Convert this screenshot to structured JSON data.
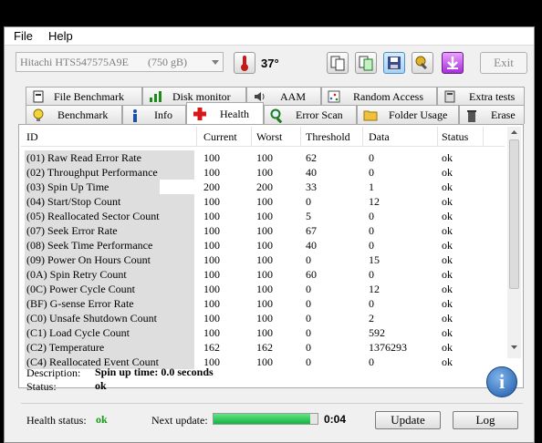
{
  "menu": [
    "File",
    "Help"
  ],
  "toolbar": {
    "drive": "Hitachi HTS547575A9E",
    "capacity": "(750 gB)",
    "temperature": "37°",
    "exit_label": "Exit",
    "icons": [
      "thermometer-icon",
      "copy-icon",
      "copy-green-icon",
      "save-icon",
      "tools-icon",
      "download-icon"
    ]
  },
  "tabs_top": [
    "File Benchmark",
    "Disk monitor",
    "AAM",
    "Random Access",
    "Extra tests"
  ],
  "tabs_bottom": [
    "Benchmark",
    "Info",
    "Health",
    "Error Scan",
    "Folder Usage",
    "Erase"
  ],
  "selected_tab": "Health",
  "table": {
    "headers": [
      "ID",
      "Current",
      "Worst",
      "Threshold",
      "Data",
      "Status"
    ],
    "rows": [
      [
        "(01) Raw Read Error Rate",
        "100",
        "100",
        "62",
        "0",
        "ok"
      ],
      [
        "(02) Throughput Performance",
        "100",
        "100",
        "40",
        "0",
        "ok"
      ],
      [
        "(03) Spin Up Time",
        "200",
        "200",
        "33",
        "1",
        "ok"
      ],
      [
        "(04) Start/Stop Count",
        "100",
        "100",
        "0",
        "12",
        "ok"
      ],
      [
        "(05) Reallocated Sector Count",
        "100",
        "100",
        "5",
        "0",
        "ok"
      ],
      [
        "(07) Seek Error Rate",
        "100",
        "100",
        "67",
        "0",
        "ok"
      ],
      [
        "(08) Seek Time Performance",
        "100",
        "100",
        "40",
        "0",
        "ok"
      ],
      [
        "(09) Power On Hours Count",
        "100",
        "100",
        "0",
        "15",
        "ok"
      ],
      [
        "(0A) Spin Retry Count",
        "100",
        "100",
        "60",
        "0",
        "ok"
      ],
      [
        "(0C) Power Cycle Count",
        "100",
        "100",
        "0",
        "12",
        "ok"
      ],
      [
        "(BF) G-sense Error Rate",
        "100",
        "100",
        "0",
        "0",
        "ok"
      ],
      [
        "(C0) Unsafe Shutdown Count",
        "100",
        "100",
        "0",
        "2",
        "ok"
      ],
      [
        "(C1) Load Cycle Count",
        "100",
        "100",
        "0",
        "592",
        "ok"
      ],
      [
        "(C2) Temperature",
        "162",
        "162",
        "0",
        "1376293",
        "ok"
      ],
      [
        "(C4) Reallocated Event Count",
        "100",
        "100",
        "0",
        "0",
        "ok"
      ]
    ],
    "selected_row": 2
  },
  "description": {
    "label": "Description:",
    "value": "Spin up time: 0.0 seconds",
    "status_label": "Status:",
    "status_value": "ok"
  },
  "footer": {
    "health_label": "Health status:",
    "health_value": "ok",
    "next_update_label": "Next update:",
    "progress": 0.93,
    "countdown": "0:04",
    "update_button": "Update",
    "log_button": "Log"
  },
  "colors": {
    "ok_green": "#1a9a1a",
    "progress": "#18bb45",
    "selected_tab": "#ffffff"
  }
}
